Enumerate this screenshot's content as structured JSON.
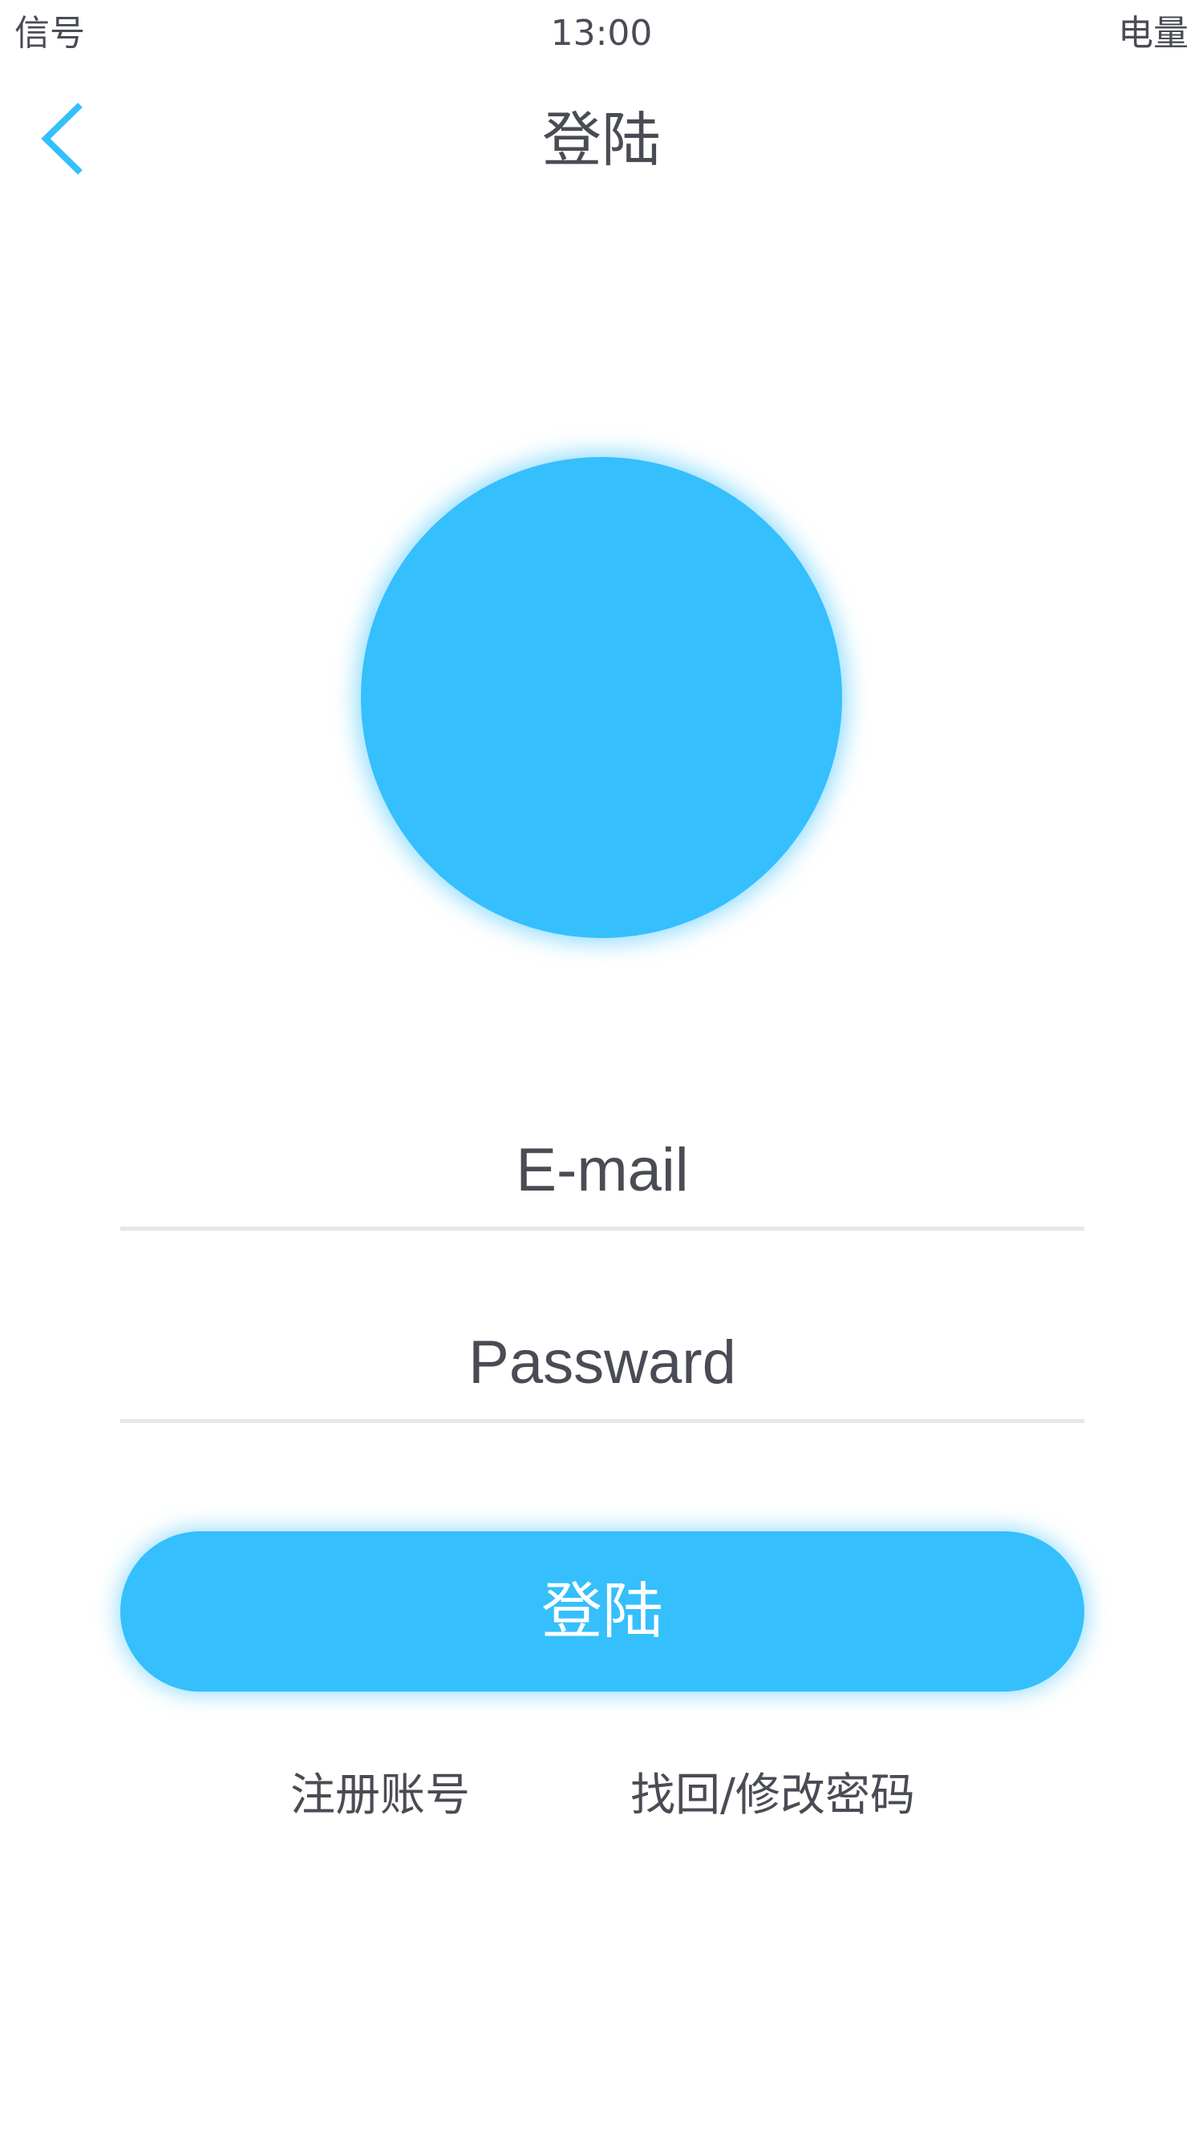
{
  "status_bar": {
    "signal": "信号",
    "time": "13:00",
    "battery": "电量"
  },
  "nav": {
    "title": "登陆",
    "back_icon": "chevron-left-icon"
  },
  "avatar": {
    "color": "#35bffc"
  },
  "form": {
    "email_placeholder": "E-mail",
    "password_placeholder": "Passward",
    "login_label": "登陆"
  },
  "links": {
    "register": "注册账号",
    "recover": "找回/修改密码"
  },
  "colors": {
    "accent": "#35bffc",
    "text": "#4a4c55",
    "divider": "#e6e6e6"
  }
}
